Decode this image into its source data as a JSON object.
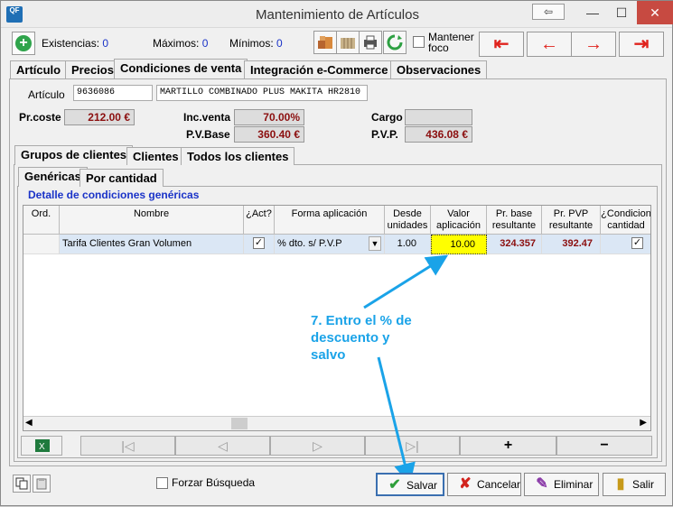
{
  "window": {
    "title": "Mantenimiento de Artículos",
    "icon_label": "QF",
    "restore_glyph": "⇦",
    "minimize_glyph": "—",
    "maximize_glyph": "☐",
    "close_glyph": "✕"
  },
  "toolbar": {
    "add_glyph": "+",
    "existencias_label": "Existencias:",
    "existencias_value": "0",
    "maximos_label": "Máximos:",
    "maximos_value": "0",
    "minimos_label": "Mínimos:",
    "minimos_value": "0",
    "mantener_foco_label": "Mantener foco",
    "nav_first": "⇤",
    "nav_prev": "←",
    "nav_next": "→",
    "nav_last": "⇥"
  },
  "main_tabs": [
    "Artículo",
    "Precios",
    "Condiciones de venta",
    "Integración e-Commerce",
    "Observaciones"
  ],
  "article": {
    "label": "Artículo",
    "code": "9636086",
    "description": "MARTILLO COMBINADO PLUS MAKITA HR2810"
  },
  "prices": {
    "pr_coste_label": "Pr.coste",
    "pr_coste_value": "212.00 €",
    "inc_venta_label": "Inc.venta",
    "inc_venta_value": "70.00%",
    "pv_base_label": "P.V.Base",
    "pv_base_value": "360.40 €",
    "cargo_label": "Cargo",
    "cargo_value": "",
    "pvp_label": "P.V.P.",
    "pvp_value": "436.08 €"
  },
  "sub_tabs": [
    "Grupos de clientes",
    "Clientes",
    "Todos los clientes"
  ],
  "inner_tabs": [
    "Genéricas",
    "Por cantidad"
  ],
  "group_title": "Detalle de condiciones genéricas",
  "grid": {
    "headers": [
      "Ord.",
      "Nombre",
      "¿Act?",
      "Forma aplicación",
      "Desde unidades",
      "Valor aplicación",
      "Pr. base resultante",
      "Pr. PVP resultante",
      "¿Condicion cantidad"
    ],
    "row": {
      "ord": "",
      "nombre": "Tarifa Clientes Gran Volumen",
      "activo": "✓",
      "forma": "% dto. s/ P.V.P",
      "desde": "1.00",
      "valor": "10.00",
      "pr_base": "324.357",
      "pr_pvp": "392.47",
      "condicion": "✓"
    }
  },
  "bottom_nav": [
    "",
    "|◁",
    "◁",
    "▷",
    "▷|",
    "+",
    "−"
  ],
  "annotation": "7. Entro el % de descuento y salvo",
  "footer": {
    "forzar_label": "Forzar Búsqueda",
    "salvar": "Salvar",
    "cancelar": "Cancelar",
    "eliminar": "Eliminar",
    "salir": "Salir"
  },
  "colors": {
    "money_text": "#8b0e0e",
    "accent_blue": "#1a33c8",
    "highlight_yellow": "#ffff00",
    "annotation": "#1aa3e8"
  }
}
